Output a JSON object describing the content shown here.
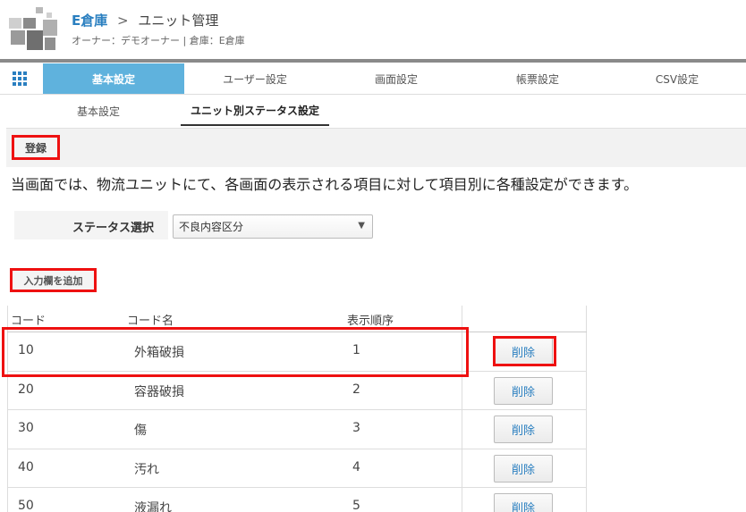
{
  "header": {
    "warehouse": "E倉庫",
    "separator": ">",
    "page": "ユニット管理",
    "subline": "オーナー：デモオーナー | 倉庫：E倉庫"
  },
  "nav": {
    "tabs": [
      {
        "label": "基本設定",
        "active": true
      },
      {
        "label": "ユーザー設定",
        "active": false
      },
      {
        "label": "画面設定",
        "active": false
      },
      {
        "label": "帳票設定",
        "active": false
      },
      {
        "label": "CSV設定",
        "active": false
      }
    ]
  },
  "subnav": {
    "tabs": [
      {
        "label": "基本設定",
        "active": false
      },
      {
        "label": "ユニット別ステータス設定",
        "active": true
      }
    ]
  },
  "toolbar": {
    "register_label": "登録"
  },
  "description": "当画面では、物流ユニットにて、各画面の表示される項目に対して項目別に各種設定ができます。",
  "status": {
    "label": "ステータス選択",
    "selected": "不良内容区分",
    "arrow": "▼"
  },
  "add_row_label": "入力欄を追加",
  "table": {
    "headers": [
      "コード",
      "コード名",
      "表示順序",
      ""
    ],
    "delete_label": "削除",
    "rows": [
      {
        "code": "10",
        "name": "外箱破損",
        "order": "1"
      },
      {
        "code": "20",
        "name": "容器破損",
        "order": "2"
      },
      {
        "code": "30",
        "name": "傷",
        "order": "3"
      },
      {
        "code": "40",
        "name": "汚れ",
        "order": "4"
      },
      {
        "code": "50",
        "name": "液漏れ",
        "order": "5"
      }
    ]
  },
  "colors": {
    "accent": "#5fb2dd",
    "link": "#2a7fc0",
    "highlight": "#e11111"
  },
  "icons": {
    "logo": "squares-logo-icon",
    "grid": "grid-menu-icon",
    "dropdown": "chevron-down-icon"
  }
}
